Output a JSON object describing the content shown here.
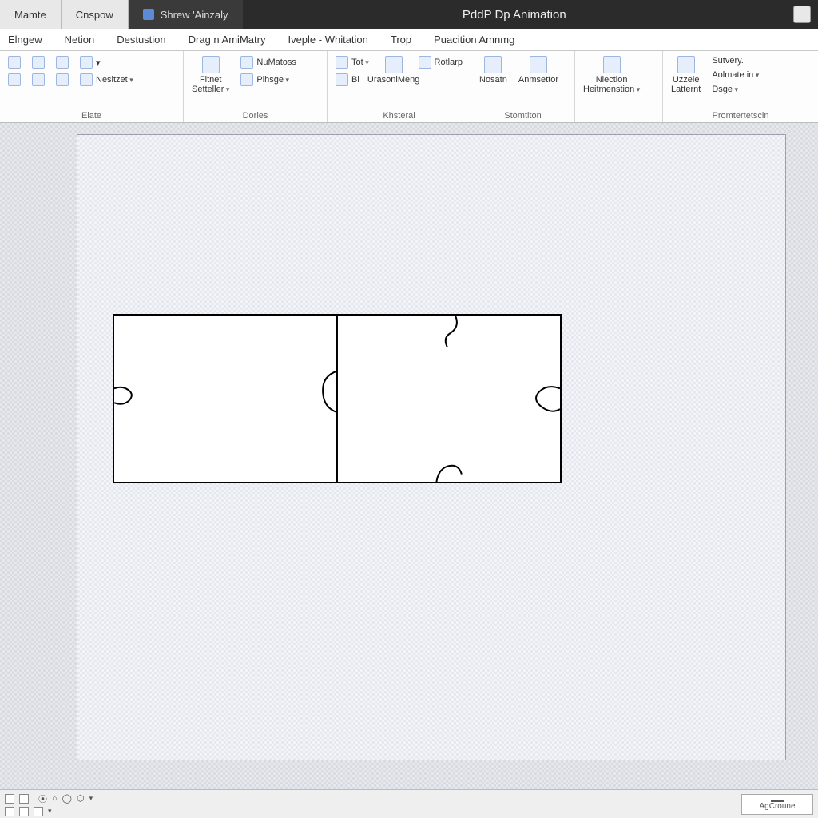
{
  "titlebar": {
    "tabs": [
      "Mamte",
      "Cnspow"
    ],
    "secondary": "Shrew 'Ainzaly",
    "center": "PddP Dp Animation"
  },
  "ribbon_tabs": [
    "Elngew",
    "Netion",
    "Destustion",
    "Drag n AmiMatry",
    "Iveple - Whitation",
    "Trop",
    "Puacition Amnmg"
  ],
  "ribbon": {
    "groups": [
      {
        "label": "Elate",
        "items": [
          {
            "name": "gallery-1",
            "label": ""
          },
          {
            "name": "gallery-2",
            "label": ""
          },
          {
            "name": "gallery-3",
            "label": ""
          },
          {
            "name": "resize-menu",
            "label": "Nesitzet",
            "caret": true
          }
        ]
      },
      {
        "label": "Dories",
        "items": [
          {
            "name": "fit-btn",
            "label": "Fitnet"
          },
          {
            "name": "settler-menu",
            "label": "Setteller",
            "caret": true
          },
          {
            "name": "numatos-btn",
            "label": "NuMatoss"
          },
          {
            "name": "pihsge-menu",
            "label": "Pihsge",
            "caret": true
          }
        ]
      },
      {
        "label": "Khsteral",
        "items": [
          {
            "name": "tot-menu",
            "label": "Tot",
            "caret": true
          },
          {
            "name": "bi-btn",
            "label": "Bi"
          },
          {
            "name": "urason-btn",
            "label": "UrasoniMeng"
          },
          {
            "name": "rotlarp-btn",
            "label": "Rotlarp"
          }
        ]
      },
      {
        "label": "Stomtiton",
        "items": [
          {
            "name": "nosatn-btn",
            "label": "Nosatn"
          },
          {
            "name": "anmsettor-btn",
            "label": "Anmsettor"
          }
        ]
      },
      {
        "label": "",
        "items": [
          {
            "name": "niection-btn",
            "label": "Niection"
          },
          {
            "name": "heitmenation-menu",
            "label": "Heitmenstion",
            "caret": true
          }
        ]
      },
      {
        "label": "Promtertetscin",
        "items": [
          {
            "name": "uzzele-btn",
            "label": "Uzzele"
          },
          {
            "name": "latternt-btn",
            "label": "Latternt"
          },
          {
            "name": "satvery-btn",
            "label": "Sutvery."
          },
          {
            "name": "aolmate-menu",
            "label": "Aolmate in",
            "caret": true
          },
          {
            "name": "dsge-menu",
            "label": "Dsge",
            "caret": true
          }
        ]
      }
    ]
  },
  "statusbar": {
    "right_label": "AgCroune"
  }
}
